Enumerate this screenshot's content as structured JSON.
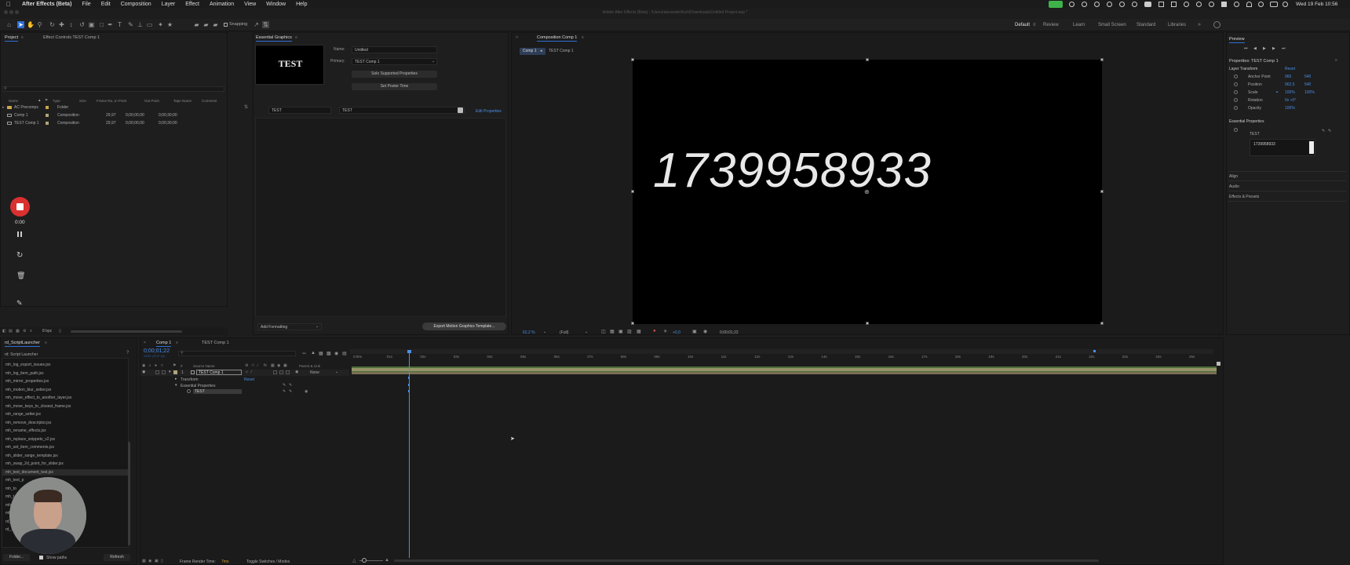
{
  "menubar": {
    "app_name": "After Effects (Beta)",
    "items": [
      "File",
      "Edit",
      "Composition",
      "Layer",
      "Effect",
      "Animation",
      "View",
      "Window",
      "Help"
    ],
    "clock": "Wed 19 Feb 10:56"
  },
  "window_title": "Adobe After Effects (Beta) - /Users/alexanderfisch/Downloads/Untitled Project.aep *",
  "toolbar": {
    "snapping_label": "Snapping",
    "workspaces": [
      "Default",
      "Review",
      "Learn",
      "Small Screen",
      "Standard",
      "Libraries"
    ],
    "active_workspace": "Default"
  },
  "project_panel": {
    "tab_project": "Project",
    "tab_effect_controls": "Effect Controls TEST Comp 1",
    "columns": [
      "Name",
      "Type",
      "Size",
      "Frame Ra...",
      "In Point",
      "Out Point",
      "Tape Name",
      "Comment"
    ],
    "items": [
      {
        "name": "AC Precomps",
        "type": "Folder",
        "fps": "",
        "in": "",
        "out": ""
      },
      {
        "name": "Comp 1",
        "type": "Composition",
        "fps": "29,97",
        "in": "0;00;00;00",
        "out": "0;00;30;00"
      },
      {
        "name": "TEST Comp 1",
        "type": "Composition",
        "fps": "29,97",
        "in": "0;00;00;00",
        "out": "0;00;30;00"
      }
    ],
    "bpc": "8 bpc"
  },
  "recorder": {
    "time": "0:00"
  },
  "essential_graphics": {
    "tab": "Essential Graphics",
    "poster_text": "TEST",
    "name_label": "Name:",
    "name_value": "Untitled",
    "primary_label": "Primary:",
    "primary_value": "TEST Comp 1",
    "solo_button": "Solo Supported Properties",
    "poster_button": "Set Poster Time",
    "prop_name": "TEST",
    "prop_value": "TEST",
    "edit_properties": "Edit Properties",
    "add_formatting": "Add Formatting",
    "export_button": "Export Motion Graphics Template..."
  },
  "composition_panel": {
    "tab": "Composition Comp 1",
    "breadcrumb_1": "Comp 1",
    "breadcrumb_2": "TEST Comp 1",
    "display_text": "1739958933",
    "zoom": "62,2 %",
    "resolution": "(Full)",
    "exposure": "+0,0",
    "timecode": "0;00;01;22"
  },
  "preview_panel": {
    "title": "Preview"
  },
  "properties_panel": {
    "title": "Properties: TEST Comp 1",
    "layer_transform": "Layer Transform",
    "reset": "Reset",
    "rows": [
      {
        "label": "Anchor Point",
        "v1": "960",
        "v2": "540"
      },
      {
        "label": "Position",
        "v1": "962,5",
        "v2": "540"
      },
      {
        "label": "Scale",
        "v1": "100%",
        "v2": "100%"
      },
      {
        "label": "Rotation",
        "v1": "0x +0°",
        "v2": ""
      },
      {
        "label": "Opacity",
        "v1": "100%",
        "v2": ""
      }
    ],
    "essential_properties": "Essential Properties",
    "ep_item": "TEST",
    "ep_value": "1739958933",
    "sections": [
      "Align",
      "Audio",
      "Effects & Presets"
    ]
  },
  "script_launcher": {
    "tab": "rd_ScriptLauncher",
    "header": "rd: Script Launcher",
    "scripts": [
      "mh_log_export_issues.jsx",
      "mh_log_item_path.jsx",
      "mh_mirror_properties.jsx",
      "mh_motion_blur_setter.jsx",
      "mh_move_effect_to_another_layer.jsx",
      "mh_move_keys_to_closest_frame.jsx",
      "mh_range_setter.jsx",
      "mh_remove_descriptor.jsx",
      "mh_rename_effects.jsx",
      "mh_replace_snippets_v2.jsx",
      "mh_set_item_comments.jsx",
      "mh_slider_range_template.jsx",
      "mh_swap_2d_point_for_slider.jsx",
      "mh_text_document_test.jsx",
      "mh_text_p",
      "mh_to",
      "mh_t",
      "mh",
      "mh",
      "rd_",
      "rd_Scrip"
    ],
    "selected_index": 13,
    "folder_button": "Folder...",
    "show_paths": "Show paths",
    "refresh_button": "Refresh"
  },
  "timeline": {
    "tab_comp1": "Comp 1",
    "tab_test": "TEST Comp 1",
    "timecode": "0;00;01;22",
    "timecode_sub": "00052 (29.97 fps)",
    "col_source": "Source Name",
    "col_parent": "Parent & Link",
    "layer_num": "1",
    "layer_name": "TEST Comp 1",
    "layer_parent": "None",
    "transform": "Transform",
    "transform_reset": "Reset",
    "essential_props": "Essential Properties",
    "ep_test": "TEST",
    "ruler": [
      "0:00s",
      "01s",
      "02s",
      "03s",
      "04s",
      "05s",
      "06s",
      "07s",
      "08s",
      "09s",
      "10s",
      "11s",
      "12s",
      "13s",
      "14s",
      "15s",
      "16s",
      "17s",
      "18s",
      "19s",
      "20s",
      "21s",
      "22s",
      "23s",
      "24s",
      "25s"
    ],
    "frame_render_label": "Frame Render Time:",
    "frame_render_value": "7ms",
    "toggle_label": "Toggle Switches / Modes"
  }
}
